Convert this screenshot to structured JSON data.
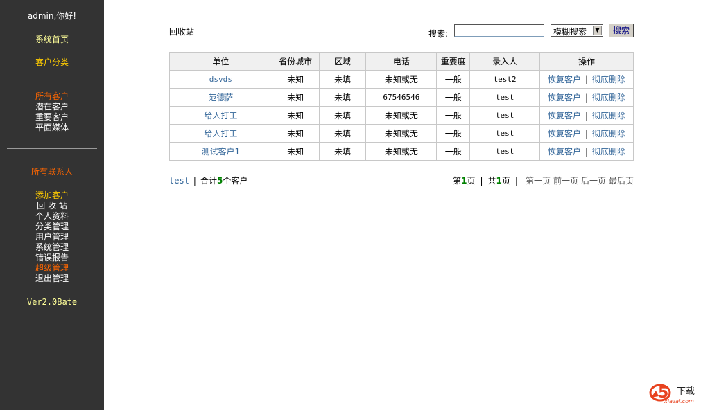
{
  "sidebar": {
    "greeting": "admin,你好!",
    "home": "系统首页",
    "category": "客户分类",
    "customers": [
      "所有客户",
      "潜在客户",
      "重要客户",
      "平面媒体"
    ],
    "contacts": "所有联系人",
    "menu": [
      "添加客户",
      "回 收 站",
      "个人资料",
      "分类管理",
      "用户管理",
      "系统管理",
      "错误报告",
      "超级管理",
      "退出管理"
    ],
    "version": "Ver2.0Bate"
  },
  "page": {
    "title": "回收站",
    "search_label": "搜索:",
    "search_value": "",
    "search_mode": "模糊搜索",
    "search_button": "搜索"
  },
  "table": {
    "headers": [
      "单位",
      "省份城市",
      "区域",
      "电话",
      "重要度",
      "录入人",
      "操作"
    ],
    "rows": [
      {
        "unit": "dsvds",
        "city": "未知",
        "area": "未填",
        "phone": "未知或无",
        "level": "一般",
        "creator": "test2",
        "restore": "恢复客户",
        "delete": "彻底删除"
      },
      {
        "unit": "范德萨",
        "city": "未知",
        "area": "未填",
        "phone": "67546546",
        "level": "一般",
        "creator": "test",
        "restore": "恢复客户",
        "delete": "彻底删除"
      },
      {
        "unit": "给人打工",
        "city": "未知",
        "area": "未填",
        "phone": "未知或无",
        "level": "一般",
        "creator": "test",
        "restore": "恢复客户",
        "delete": "彻底删除"
      },
      {
        "unit": "给人打工",
        "city": "未知",
        "area": "未填",
        "phone": "未知或无",
        "level": "一般",
        "creator": "test",
        "restore": "恢复客户",
        "delete": "彻底删除"
      },
      {
        "unit": "测试客户1",
        "city": "未知",
        "area": "未填",
        "phone": "未知或无",
        "level": "一般",
        "creator": "test",
        "restore": "恢复客户",
        "delete": "彻底删除"
      }
    ]
  },
  "footer": {
    "user": "test",
    "total_prefix": "合计",
    "total_count": "5",
    "total_suffix": "个客户",
    "page_prefix": "第",
    "page_current": "1",
    "page_suffix": "页",
    "total_pages_prefix": "共",
    "total_pages": "1",
    "total_pages_suffix": "页",
    "first": "第一页",
    "prev": "前一页",
    "next": "后一页",
    "last": "最后页"
  },
  "logo": {
    "big": "5",
    "text": "下载",
    "domain": "xiazai.com"
  },
  "colors": {
    "sidebar_bg": "#333333",
    "link": "#336699",
    "orange": "#ff6600",
    "yellow": "#ffcc00",
    "count": "#008000"
  }
}
